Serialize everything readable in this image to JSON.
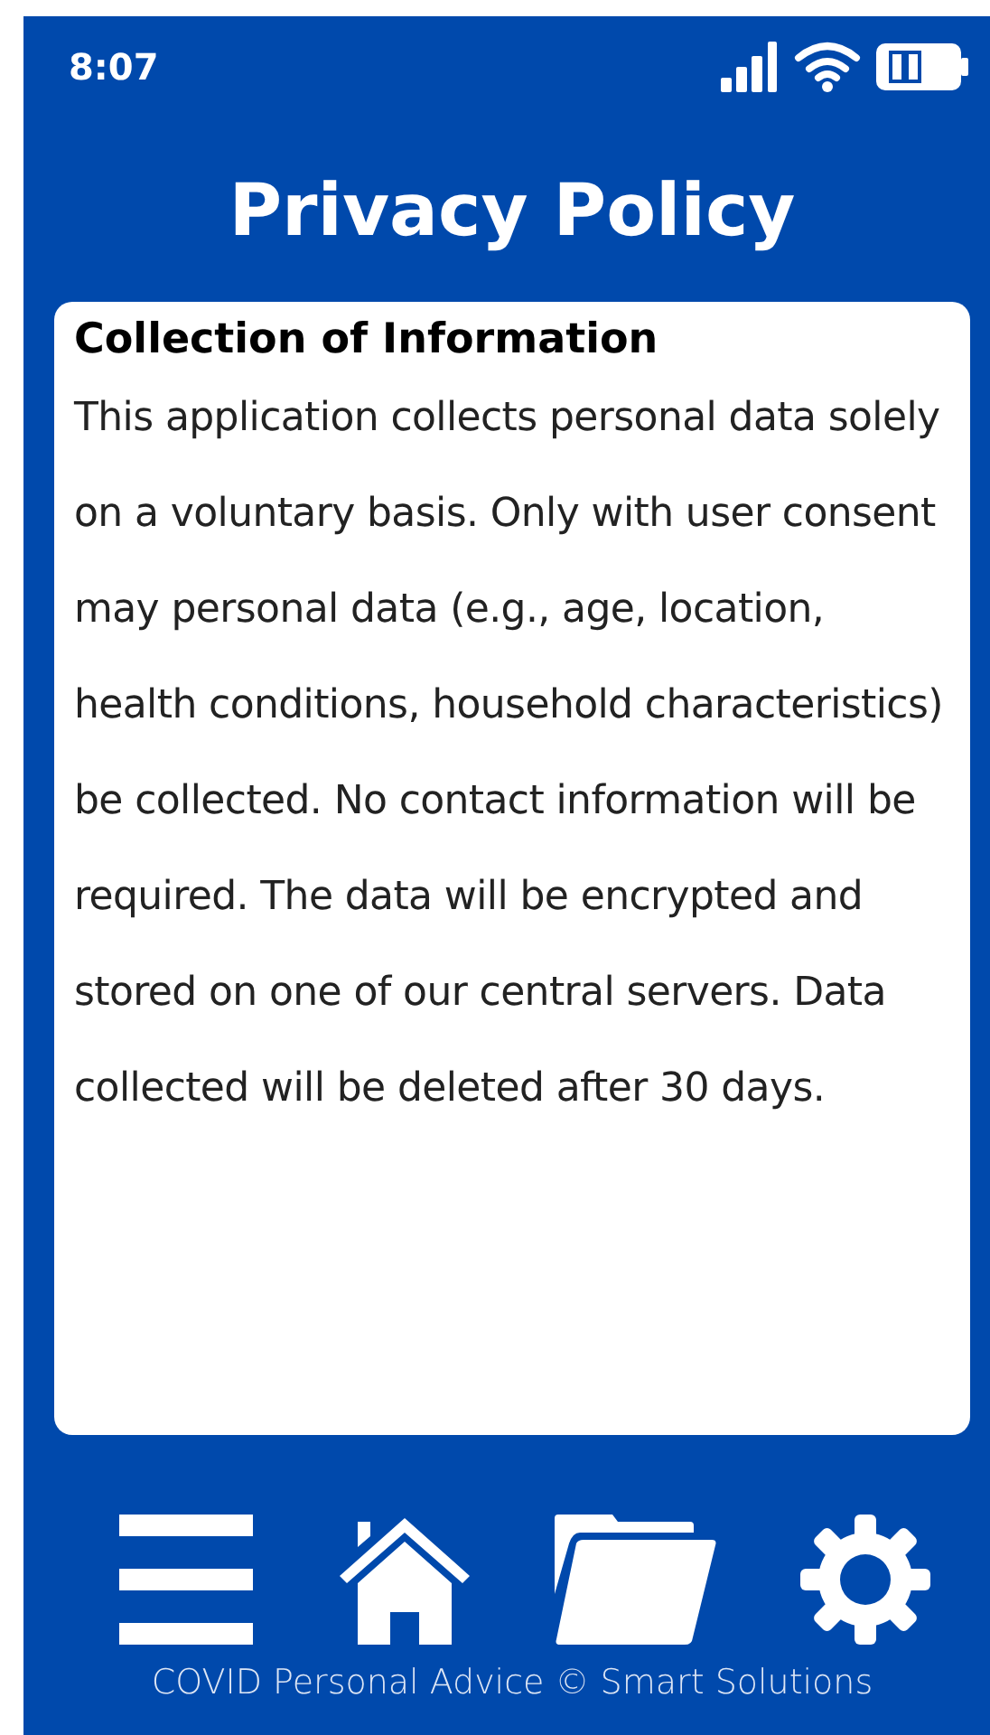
{
  "status_bar": {
    "time": "8:07"
  },
  "title": "Privacy Policy",
  "section": {
    "heading": "Collection of Information",
    "body": "This application collects personal data solely on a voluntary basis. Only with user consent may personal data (e.g., age, location, health conditions, household characteristics) be collected. No contact information will be required. The data will be encrypted and stored on one of our central servers. Data collected will be deleted after 30 days."
  },
  "nav": [
    {
      "kind": "menu"
    },
    {
      "kind": "home"
    },
    {
      "kind": "folder"
    },
    {
      "kind": "settings"
    }
  ],
  "footer": "COVID Personal Advice © Smart Solutions"
}
